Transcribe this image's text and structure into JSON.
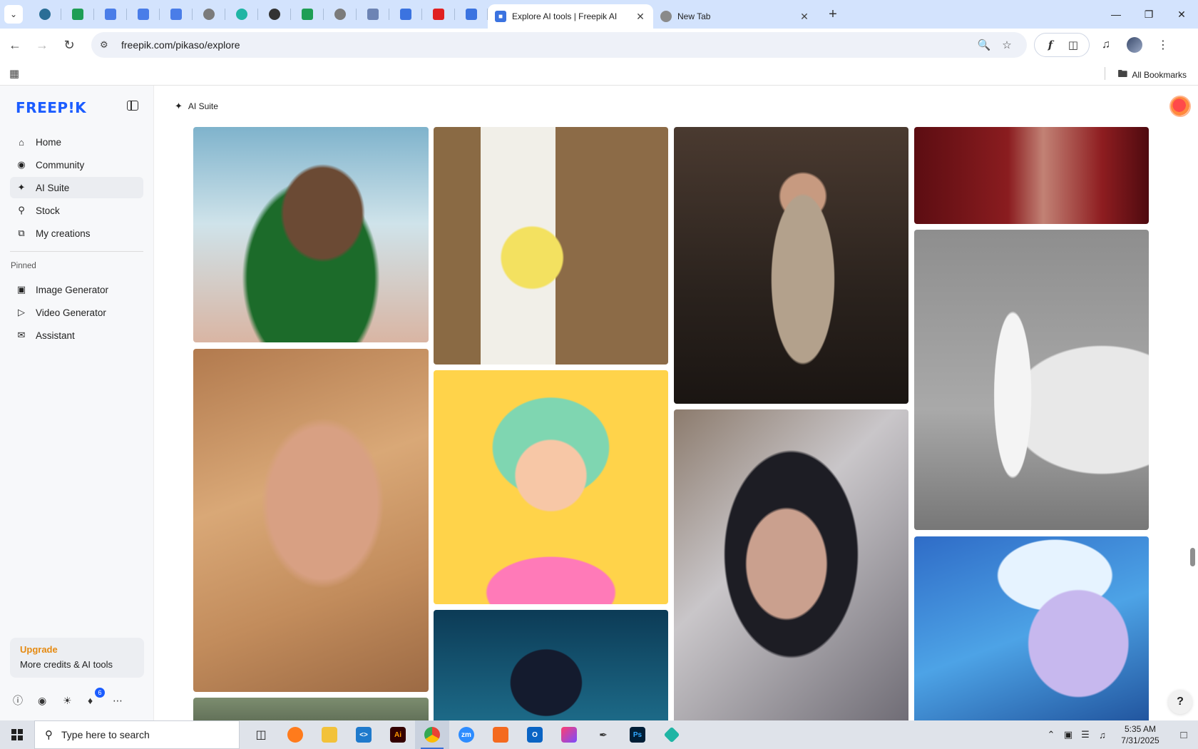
{
  "browser": {
    "pinned_tabs": [
      {
        "icon": "globe-icon",
        "color": "#2a6e96"
      },
      {
        "icon": "sheets-icon",
        "color": "#1e9e55"
      },
      {
        "icon": "docs-icon",
        "color": "#4a7de8"
      },
      {
        "icon": "docs-icon",
        "color": "#4a7de8"
      },
      {
        "icon": "docs-icon",
        "color": "#4a7de8"
      },
      {
        "icon": "globe-icon",
        "color": "#7b7b7b"
      },
      {
        "icon": "app-icon",
        "color": "#1fb5a4"
      },
      {
        "icon": "chatgpt-icon",
        "color": "#333333"
      },
      {
        "icon": "sheets-icon",
        "color": "#1e9e55"
      },
      {
        "icon": "globe-icon",
        "color": "#7b7b7b"
      },
      {
        "icon": "grid-doc-icon",
        "color": "#6d84b4"
      },
      {
        "icon": "forms-icon",
        "color": "#3b73e0"
      },
      {
        "icon": "youtube-icon",
        "color": "#e02020"
      },
      {
        "icon": "forms-icon",
        "color": "#3b73e0"
      }
    ],
    "tabs": [
      {
        "title": "Explore AI tools | Freepik AI",
        "active": true
      },
      {
        "title": "New Tab",
        "active": false
      }
    ],
    "url": "freepik.com/pikaso/explore",
    "all_bookmarks_label": "All Bookmarks"
  },
  "sidebar": {
    "logo": "FREEP!K",
    "nav": [
      {
        "label": "Home",
        "icon": "home-icon"
      },
      {
        "label": "Community",
        "icon": "globe-icon"
      },
      {
        "label": "AI Suite",
        "icon": "sparkle-icon"
      },
      {
        "label": "Stock",
        "icon": "search-icon"
      },
      {
        "label": "My creations",
        "icon": "stack-icon"
      }
    ],
    "pinned_label": "Pinned",
    "pinned": [
      {
        "label": "Image Generator",
        "icon": "image-icon"
      },
      {
        "label": "Video Generator",
        "icon": "video-icon"
      },
      {
        "label": "Assistant",
        "icon": "chat-icon"
      }
    ],
    "upgrade": {
      "title": "Upgrade",
      "subtitle": "More credits & AI tools"
    },
    "notification_count": "6"
  },
  "main": {
    "breadcrumb": "AI Suite"
  },
  "taskbar": {
    "search_placeholder": "Type here to search",
    "time": "5:35 AM",
    "date": "7/31/2025"
  },
  "colors": {
    "brand": "#1b5cff",
    "upgrade": "#e58a12"
  }
}
